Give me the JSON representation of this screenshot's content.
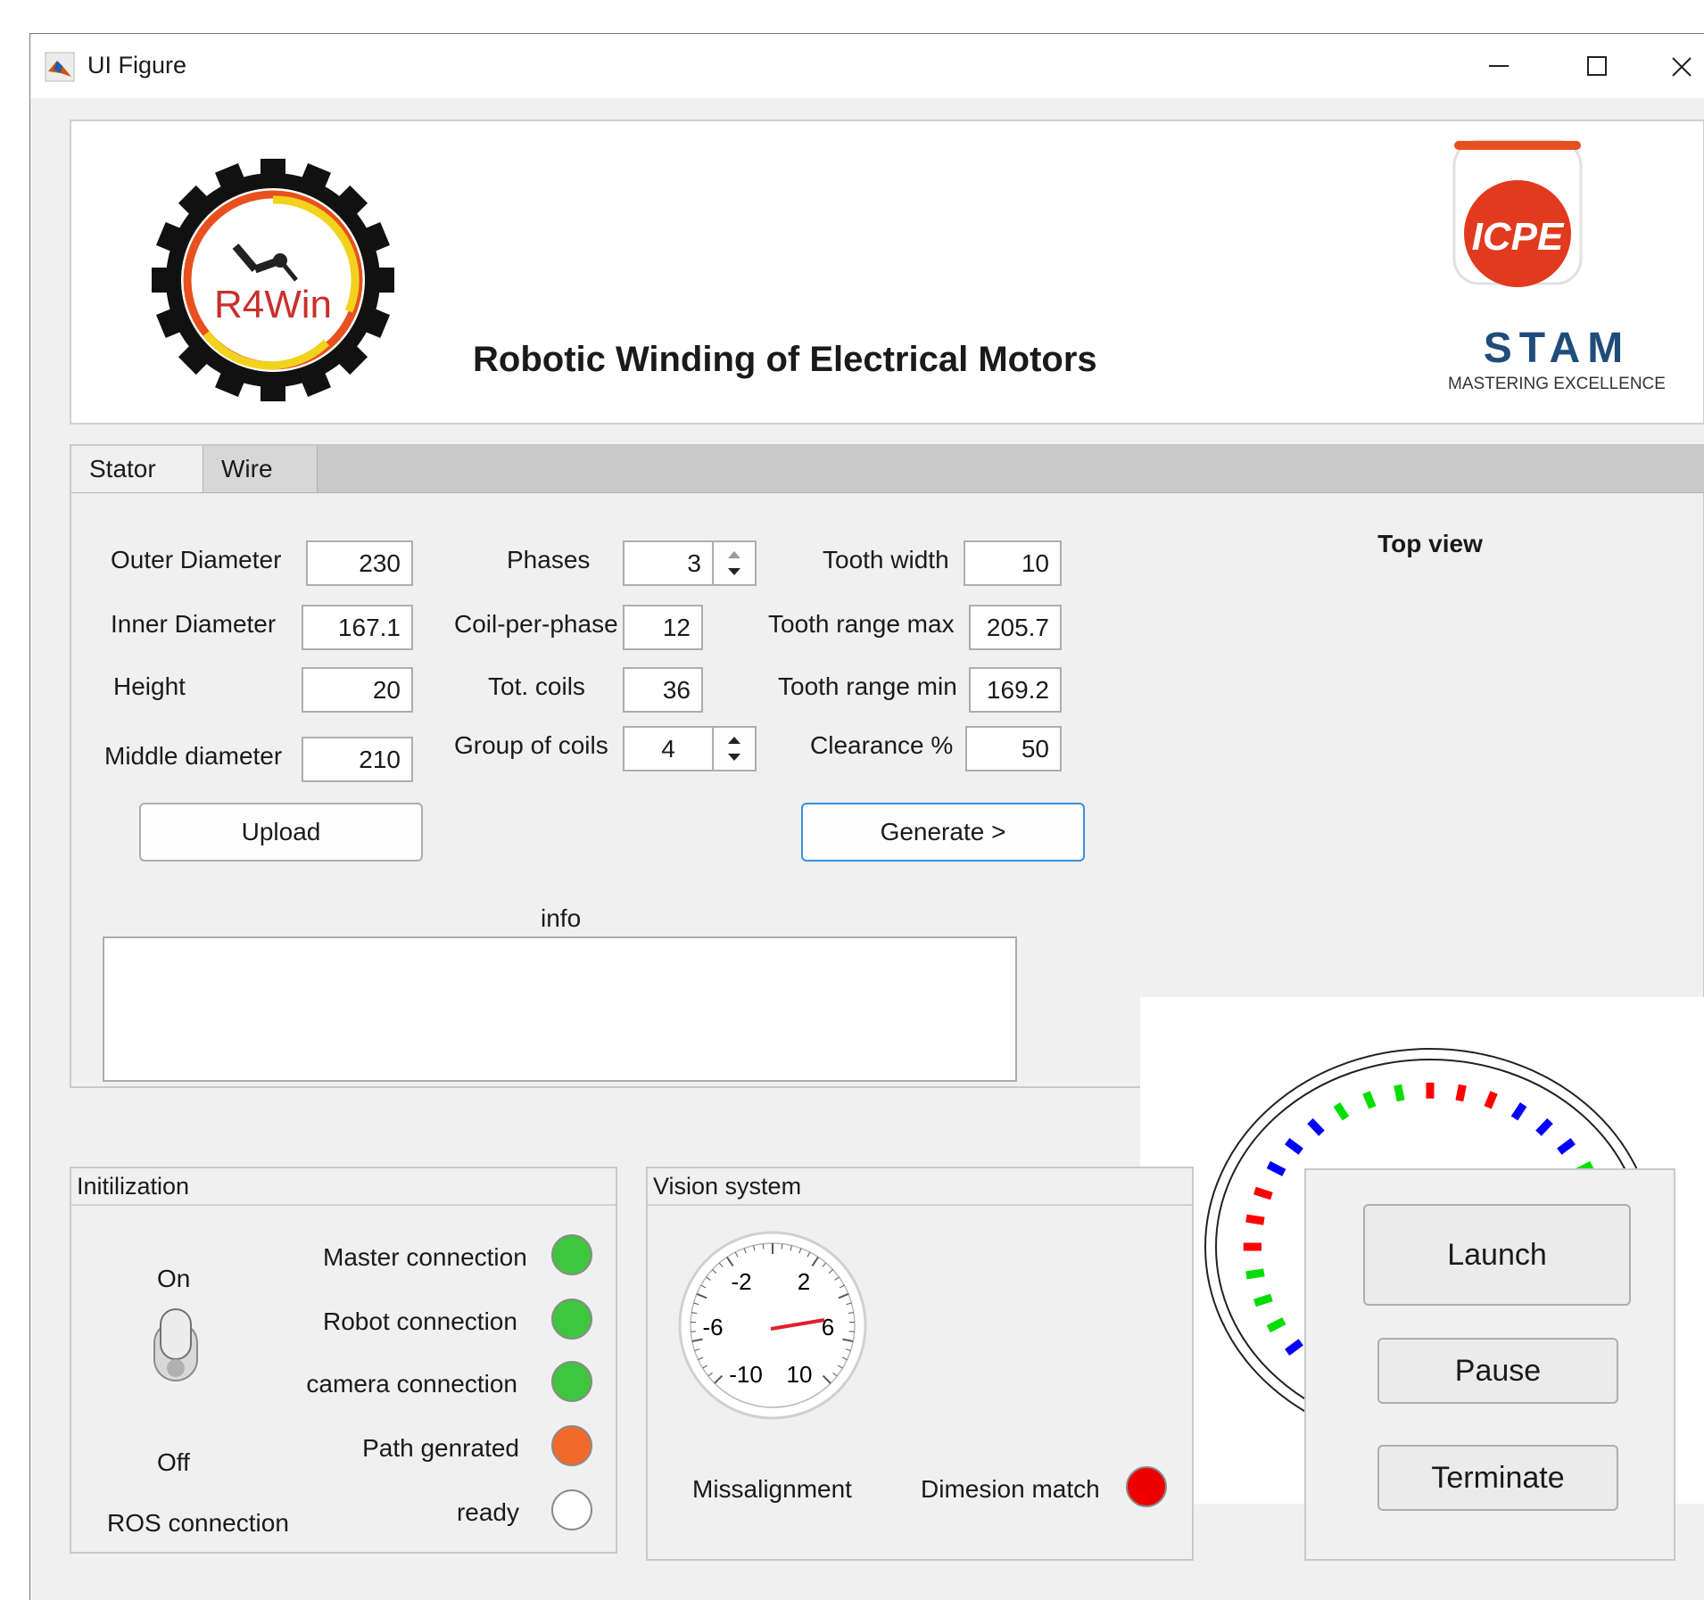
{
  "window": {
    "title": "UI Figure"
  },
  "header": {
    "app_title": "Robotic Winding of Electrical Motors",
    "logo_left_text": "R4Win",
    "logo_right_text": "ICPE",
    "logo_stam_text": "STAM",
    "logo_stam_tagline": "MASTERING EXCELLENCE"
  },
  "tabs": [
    "Stator",
    "Wire"
  ],
  "stator": {
    "outer_diameter": {
      "label": "Outer Diameter",
      "value": "230"
    },
    "inner_diameter": {
      "label": "Inner Diameter",
      "value": "167.1"
    },
    "height": {
      "label": "Height",
      "value": "20"
    },
    "middle_diameter": {
      "label": "Middle diameter",
      "value": "210"
    },
    "phases": {
      "label": "Phases",
      "value": "3"
    },
    "coil_per_phase": {
      "label": "Coil-per-phase",
      "value": "12"
    },
    "tot_coils": {
      "label": "Tot. coils",
      "value": "36"
    },
    "group_of_coils": {
      "label": "Group of coils",
      "value": "4"
    },
    "tooth_width": {
      "label": "Tooth width",
      "value": "10"
    },
    "tooth_range_max": {
      "label": "Tooth range max",
      "value": "205.7"
    },
    "tooth_range_min": {
      "label": "Tooth range min",
      "value": "169.2"
    },
    "clearance": {
      "label": "Clearance %",
      "value": "50"
    },
    "upload_label": "Upload",
    "generate_label": "Generate >",
    "info_label": "info",
    "info_value": ""
  },
  "top_view": {
    "title": "Top view",
    "coil_count": 36,
    "phase_colors": {
      "A": "#ff0000",
      "B": "#0000ff",
      "C": "#00dd00"
    }
  },
  "initialization": {
    "title": "Initilization",
    "switch_on_label": "On",
    "switch_off_label": "Off",
    "switch_state": "Off",
    "ros_label": "ROS connection",
    "lamps": [
      {
        "label": "Master connection",
        "color": "#3fc63f"
      },
      {
        "label": "Robot connection",
        "color": "#3fc63f"
      },
      {
        "label": "camera connection",
        "color": "#3fc63f"
      },
      {
        "label": "Path genrated",
        "color": "#f26a2a"
      },
      {
        "label": "ready",
        "color": "#ffffff"
      }
    ]
  },
  "vision": {
    "title": "Vision system",
    "gauge_ticks": [
      "-2",
      "2",
      "-6",
      "6",
      "-10",
      "10"
    ],
    "missalignment_label": "Missalignment",
    "dimension_label": "Dimesion match",
    "dimension_color": "#ee0000"
  },
  "controls": {
    "launch": "Launch",
    "pause": "Pause",
    "terminate": "Terminate"
  }
}
